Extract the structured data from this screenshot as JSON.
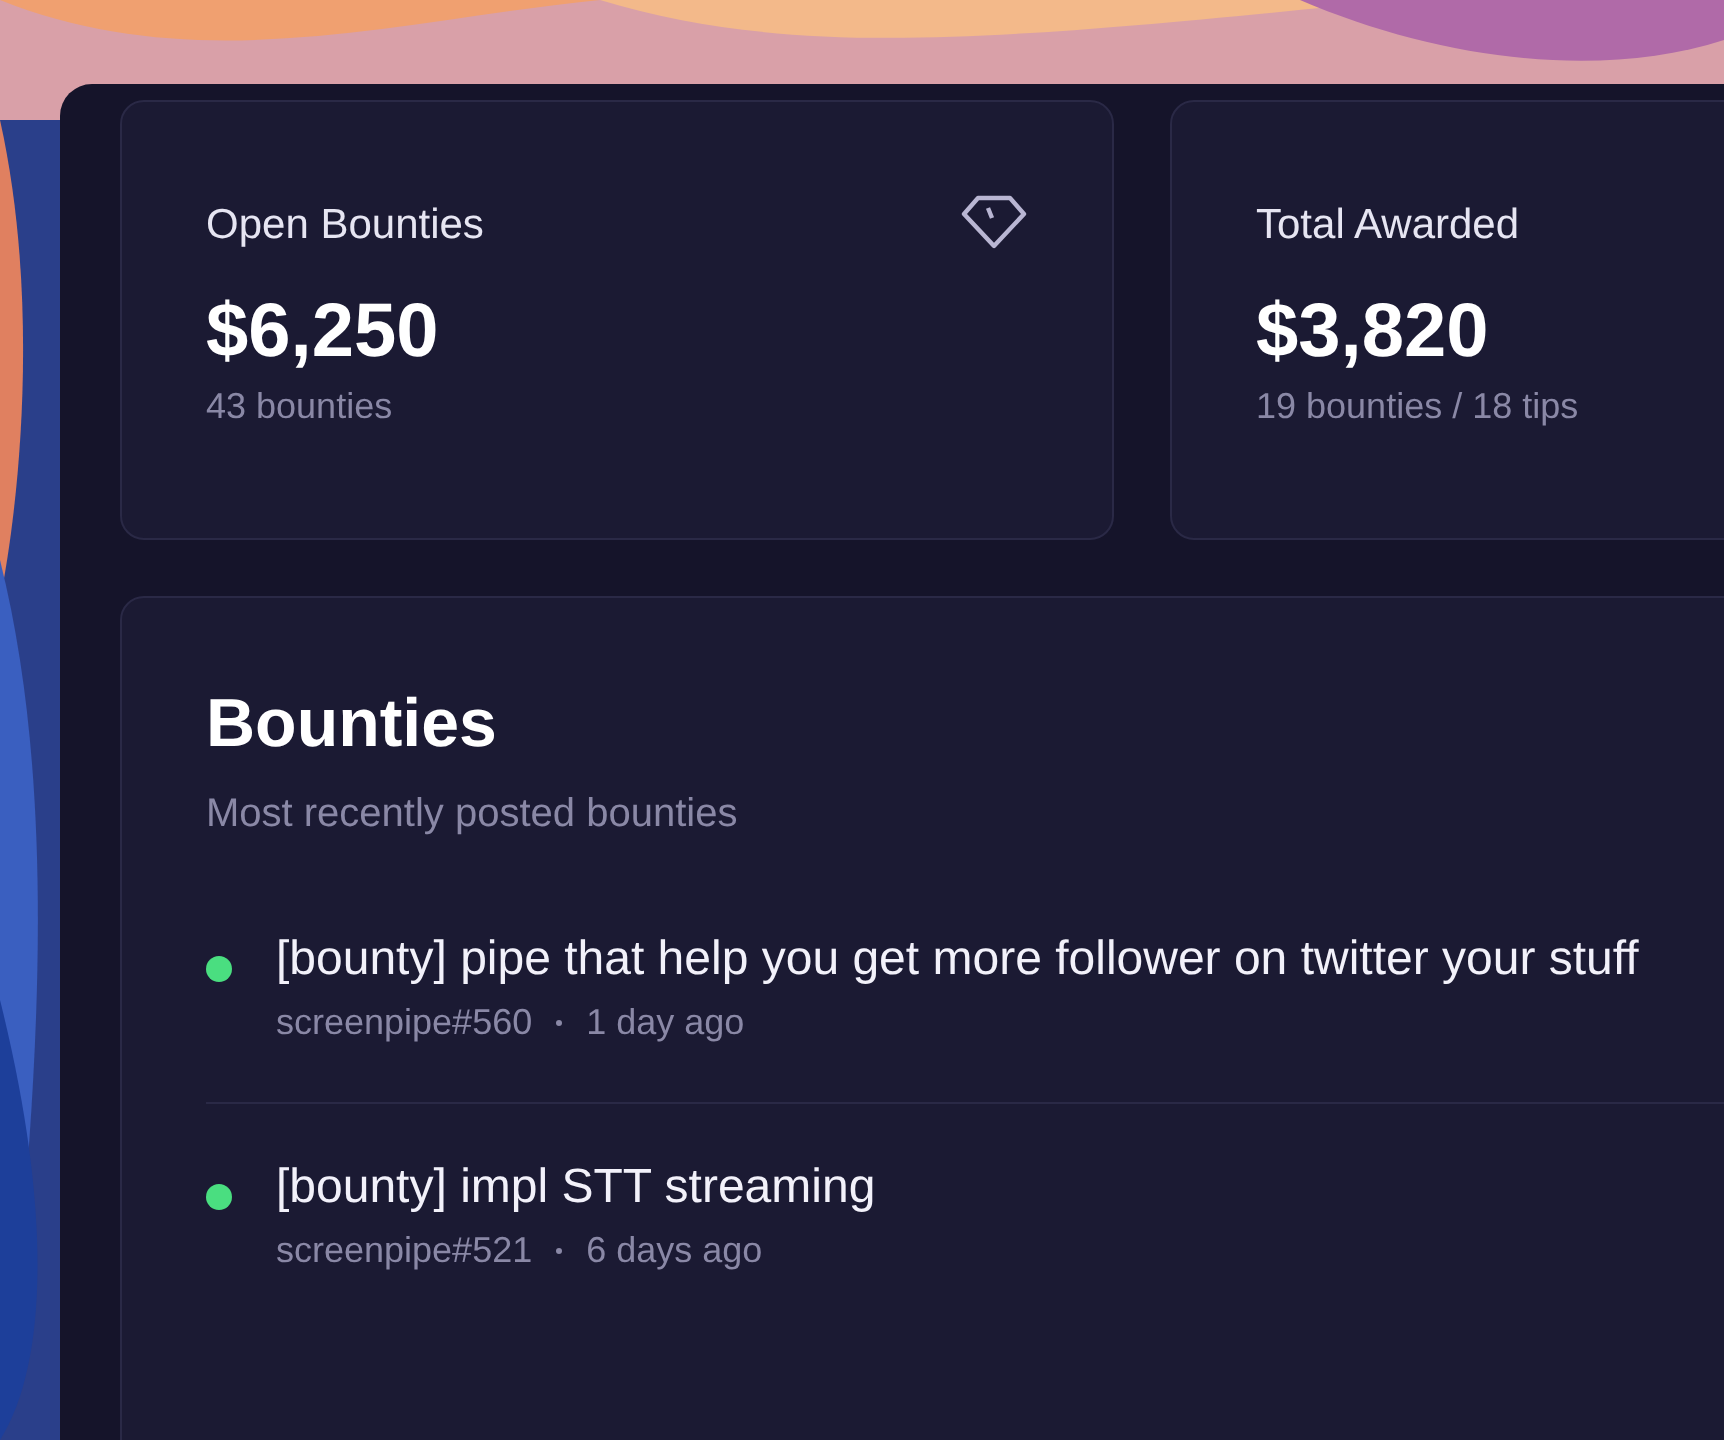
{
  "stats": [
    {
      "label": "Open Bounties",
      "value": "$6,250",
      "detail": "43 bounties"
    },
    {
      "label": "Total Awarded",
      "value": "$3,820",
      "detail": "19 bounties / 18 tips"
    }
  ],
  "bounties": {
    "title": "Bounties",
    "subtitle": "Most recently posted bounties",
    "items": [
      {
        "title": "[bounty] pipe that help you get more follower on twitter your stuff",
        "repo": "screenpipe#560",
        "age": "1 day ago",
        "color": "#4ade80"
      },
      {
        "title": "[bounty] impl STT streaming",
        "repo": "screenpipe#521",
        "age": "6 days ago",
        "color": "#4ade80"
      }
    ]
  }
}
